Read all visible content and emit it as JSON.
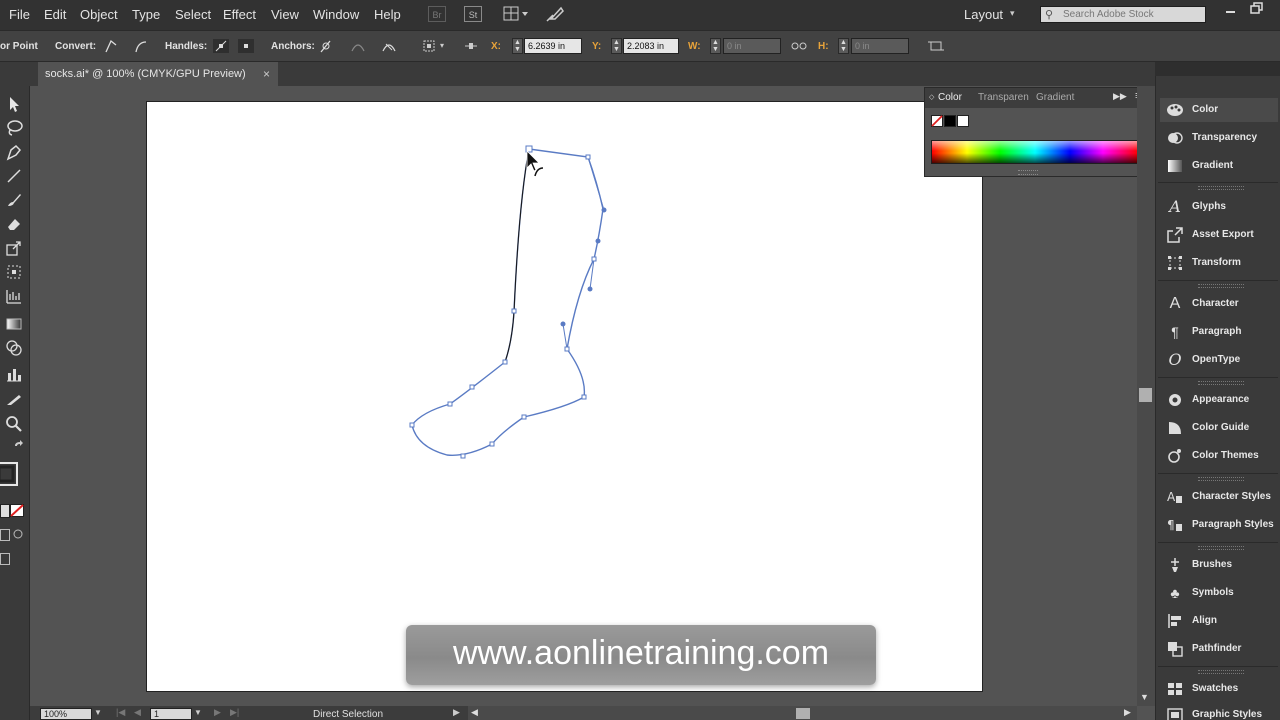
{
  "menu": {
    "items": [
      "File",
      "Edit",
      "Object",
      "Type",
      "Select",
      "Effect",
      "View",
      "Window",
      "Help"
    ],
    "br_label": "Br",
    "st_label": "St",
    "workspace": "Layout",
    "search_placeholder": "Search Adobe Stock"
  },
  "control": {
    "tool_name": "or Point",
    "convert_label": "Convert:",
    "handles_label": "Handles:",
    "anchors_label": "Anchors:",
    "x_label": "X:",
    "x_value": "6.2639 in",
    "y_label": "Y:",
    "y_value": "2.2083 in",
    "w_label": "W:",
    "w_value": "0 in",
    "h_label": "H:",
    "h_value": "0 in"
  },
  "document": {
    "tab_title": "socks.ai* @ 100% (CMYK/GPU Preview)",
    "close": "×"
  },
  "color_panel": {
    "tabs": [
      "Color",
      "Transparen",
      "Gradient"
    ]
  },
  "dock": {
    "items": [
      {
        "label": "Color",
        "icon": "color-palette-icon"
      },
      {
        "label": "Transparency",
        "icon": "transparency-icon"
      },
      {
        "label": "Gradient",
        "icon": "gradient-icon"
      },
      {
        "label": "Glyphs",
        "icon": "glyphs-icon"
      },
      {
        "label": "Asset Export",
        "icon": "asset-export-icon"
      },
      {
        "label": "Transform",
        "icon": "transform-icon"
      },
      {
        "label": "Character",
        "icon": "character-icon"
      },
      {
        "label": "Paragraph",
        "icon": "paragraph-icon"
      },
      {
        "label": "OpenType",
        "icon": "opentype-icon"
      },
      {
        "label": "Appearance",
        "icon": "appearance-icon"
      },
      {
        "label": "Color Guide",
        "icon": "color-guide-icon"
      },
      {
        "label": "Color Themes",
        "icon": "color-themes-icon"
      },
      {
        "label": "Character Styles",
        "icon": "character-styles-icon"
      },
      {
        "label": "Paragraph Styles",
        "icon": "paragraph-styles-icon"
      },
      {
        "label": "Brushes",
        "icon": "brushes-icon"
      },
      {
        "label": "Symbols",
        "icon": "symbols-icon"
      },
      {
        "label": "Align",
        "icon": "align-icon"
      },
      {
        "label": "Pathfinder",
        "icon": "pathfinder-icon"
      },
      {
        "label": "Swatches",
        "icon": "swatches-icon"
      },
      {
        "label": "Graphic Styles",
        "icon": "graphic-styles-icon"
      }
    ]
  },
  "status": {
    "zoom": "100%",
    "page": "1",
    "tool": "Direct Selection"
  },
  "watermark": "www.aonlinetraining.com",
  "colors": {
    "path_stroke": "#5a7bc4",
    "accent_orange": "#e8a33a"
  }
}
